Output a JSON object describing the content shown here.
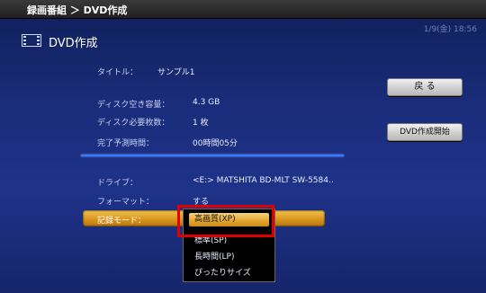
{
  "header": {
    "breadcrumb": "録画番組 ＞ DVD作成",
    "clock": "1/9(金) 18:56"
  },
  "page": {
    "title": "DVD作成"
  },
  "info": [
    {
      "label": "タイトル：",
      "value": "サンプル1"
    },
    {
      "label": "ディスク空き容量：",
      "value": "4.3 GB"
    },
    {
      "label": "ディスク必要枚数：",
      "value": "1 枚"
    },
    {
      "label": "完了予測時間：",
      "value": "00時間05分"
    }
  ],
  "settings": [
    {
      "label": "ドライブ：",
      "value": "<E:> MATSHITA BD-MLT SW-5584.."
    },
    {
      "label": "フォーマット：",
      "value": "する"
    },
    {
      "label": "記録モード：",
      "value": ""
    }
  ],
  "buttons": {
    "back": "戻 る",
    "start": "DVD作成開始"
  },
  "dropdown": {
    "options": [
      "高画質(XP)",
      "標準(SP)",
      "長時間(LP)",
      "ぴったりサイズ"
    ],
    "selected_index": 0
  }
}
